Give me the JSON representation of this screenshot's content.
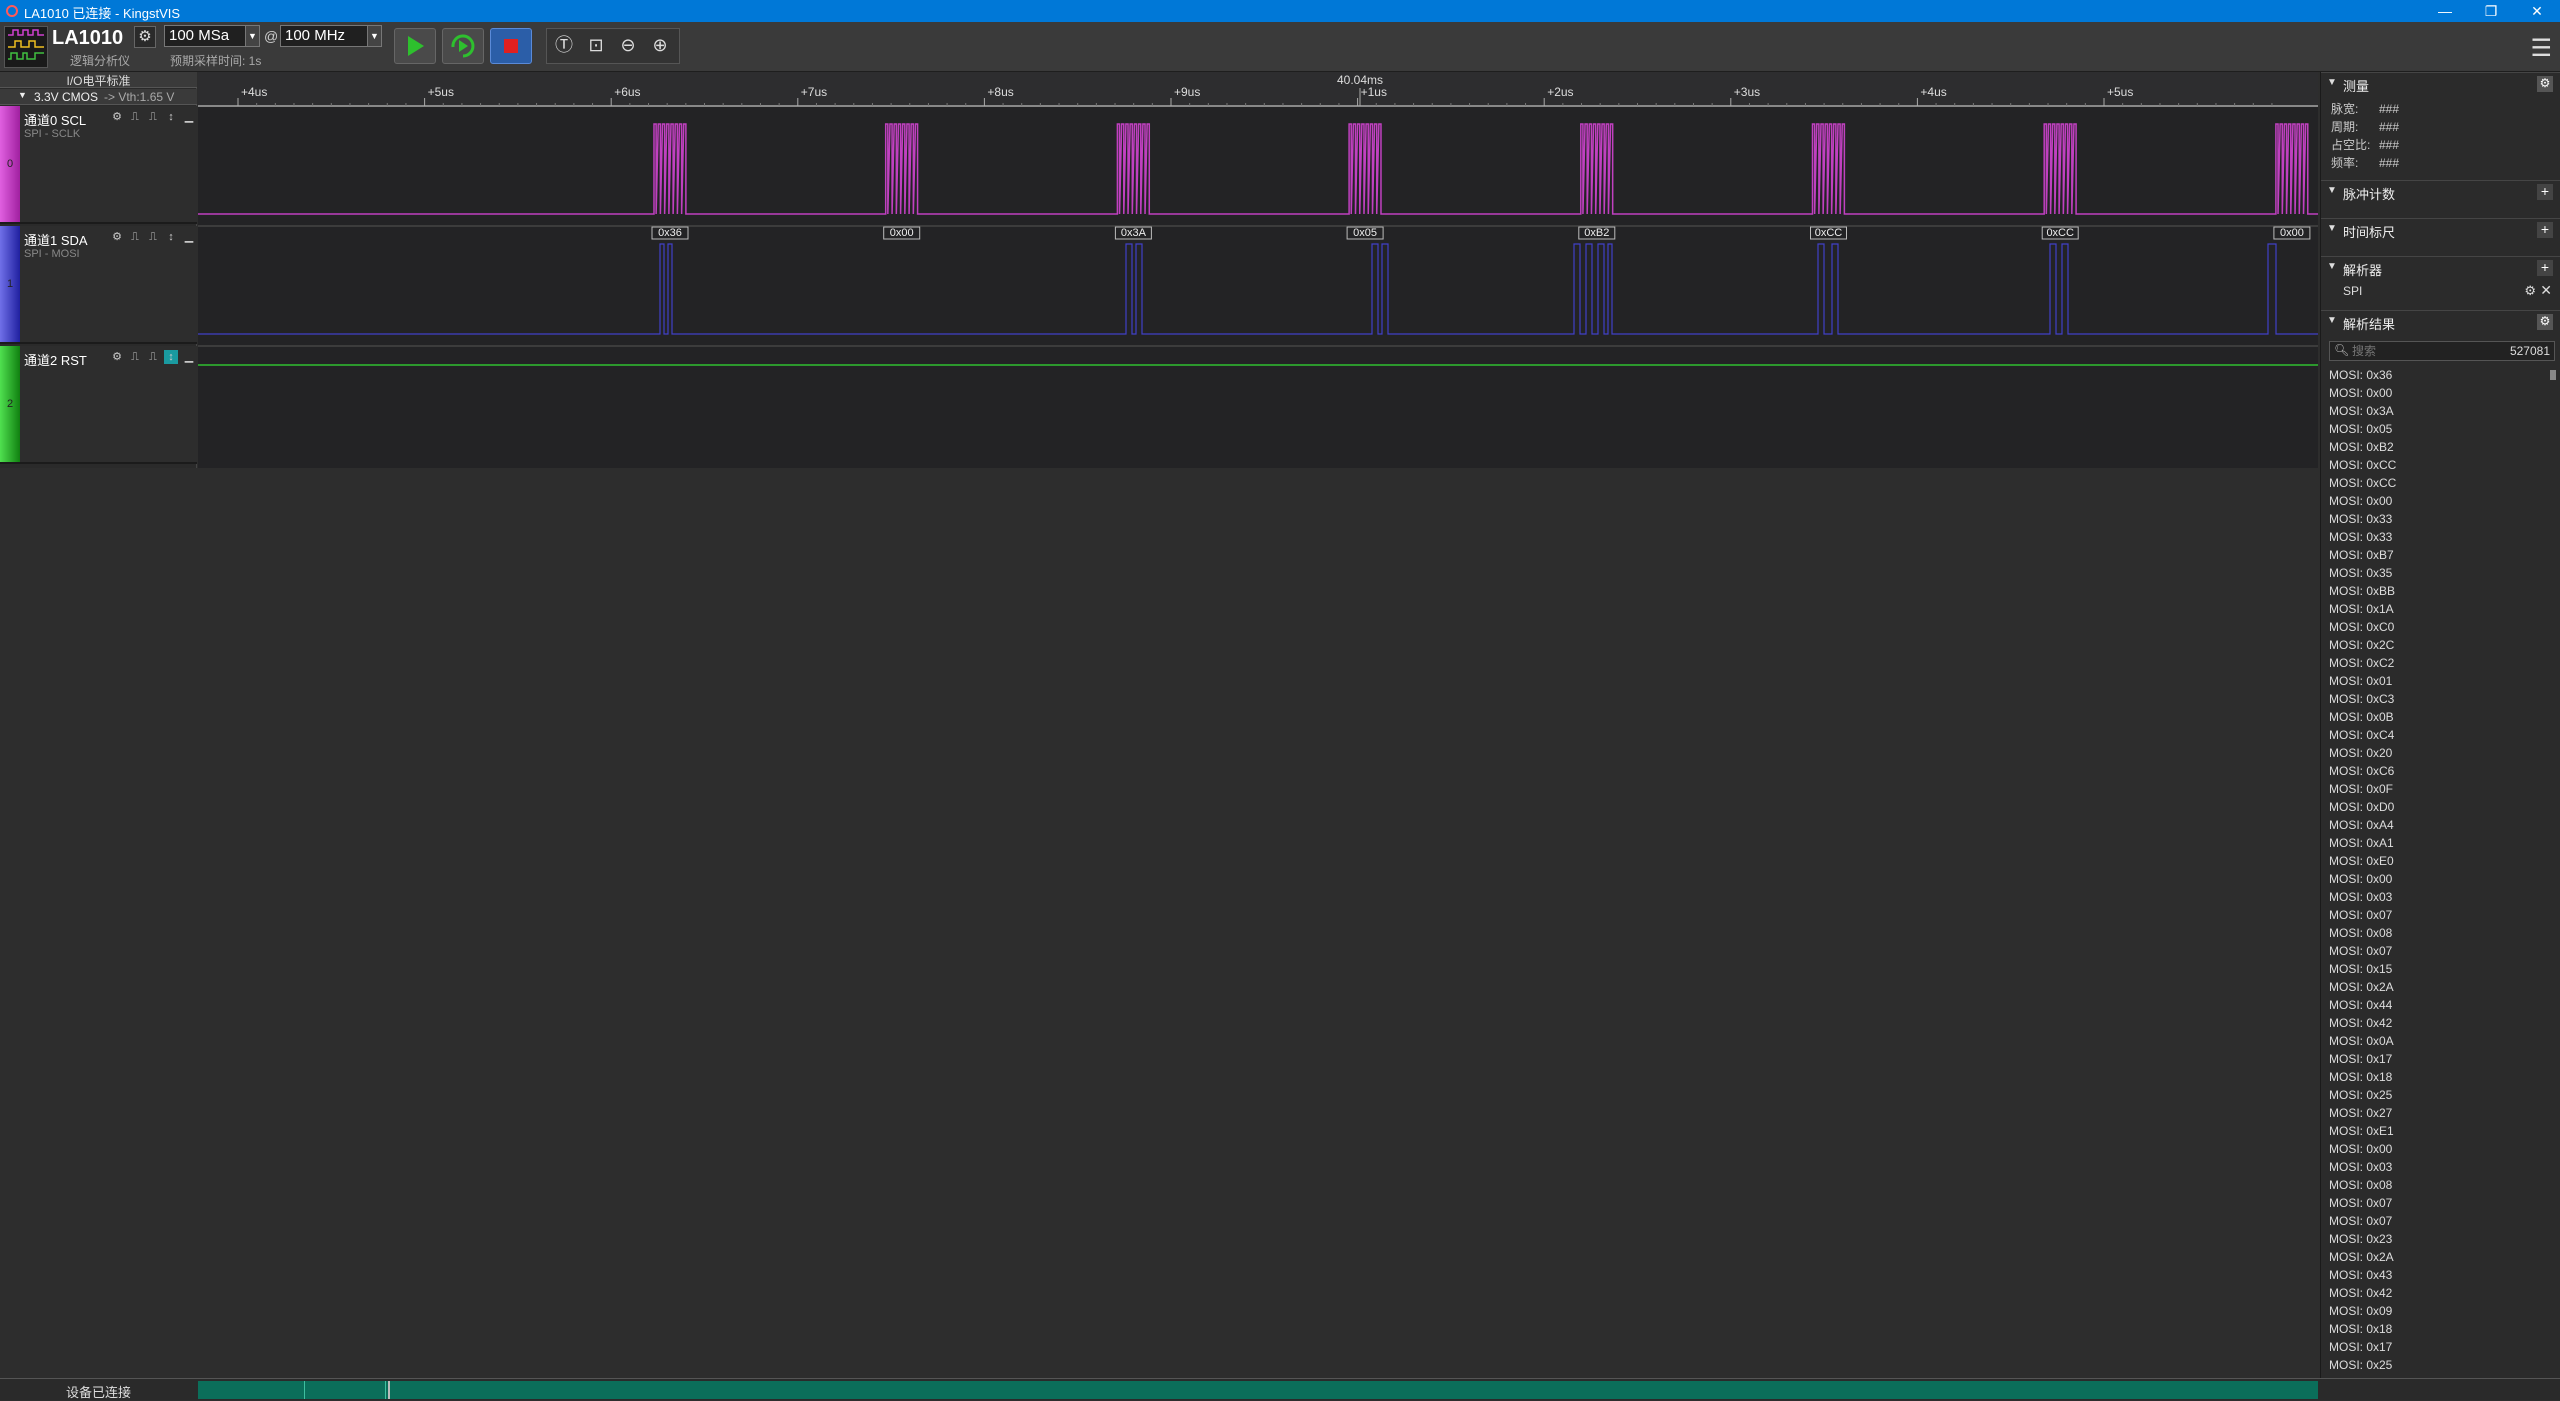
{
  "window": {
    "title": "LA1010 已连接 - KingstVIS",
    "controls": [
      "—",
      "❐",
      "✕"
    ]
  },
  "toolbar": {
    "device_name": "LA1010",
    "device_subtitle": "逻辑分析仪",
    "sample_count": "100 MSa",
    "at_symbol": "@",
    "sample_rate": "100 MHz",
    "preset_time": "预期采样时间: 1s",
    "icons": [
      "play-icon",
      "loop-run-icon",
      "stop-icon",
      "cursor-t-icon",
      "zoom-fit-icon",
      "zoom-out-icon",
      "zoom-in-icon",
      "menu-icon"
    ]
  },
  "io_standard": {
    "header": "I/O电平标准",
    "level": "3.3V CMOS",
    "vth": "-> Vth:1.65 V"
  },
  "channels": [
    {
      "index": "0",
      "name": "通道0 SCL",
      "decoder": "SPI - SCLK",
      "color": "#c040c0"
    },
    {
      "index": "1",
      "name": "通道1 SDA",
      "decoder": "SPI - MOSI",
      "color": "#4040c8"
    },
    {
      "index": "2",
      "name": "通道2 RST",
      "decoder": "",
      "color": "#30c030"
    }
  ],
  "timeline": {
    "center_time": "40.04ms",
    "ticks": [
      "+4us",
      "+5us",
      "+6us",
      "+7us",
      "+8us",
      "+9us",
      "+1us",
      "+2us",
      "+3us",
      "+4us",
      "+5us"
    ]
  },
  "decoded_bytes": [
    "0x36",
    "0x00",
    "0x3A",
    "0x05",
    "0xB2",
    "0xCC",
    "0xCC",
    "0x00"
  ],
  "right_panel": {
    "measure": {
      "title": "测量",
      "rows": [
        {
          "label": "脉宽:",
          "value": "###"
        },
        {
          "label": "周期:",
          "value": "###"
        },
        {
          "label": "占空比:",
          "value": "###"
        },
        {
          "label": "频率:",
          "value": "###"
        }
      ]
    },
    "pulse_count": {
      "title": "脉冲计数"
    },
    "time_ruler": {
      "title": "时间标尺"
    },
    "analyzer": {
      "title": "解析器",
      "item": "SPI"
    },
    "results": {
      "title": "解析结果",
      "search_placeholder": "搜索",
      "count": "527081",
      "items": [
        "MOSI: 0x36",
        "MOSI: 0x00",
        "MOSI: 0x3A",
        "MOSI: 0x05",
        "MOSI: 0xB2",
        "MOSI: 0xCC",
        "MOSI: 0xCC",
        "MOSI: 0x00",
        "MOSI: 0x33",
        "MOSI: 0x33",
        "MOSI: 0xB7",
        "MOSI: 0x35",
        "MOSI: 0xBB",
        "MOSI: 0x1A",
        "MOSI: 0xC0",
        "MOSI: 0x2C",
        "MOSI: 0xC2",
        "MOSI: 0x01",
        "MOSI: 0xC3",
        "MOSI: 0x0B",
        "MOSI: 0xC4",
        "MOSI: 0x20",
        "MOSI: 0xC6",
        "MOSI: 0x0F",
        "MOSI: 0xD0",
        "MOSI: 0xA4",
        "MOSI: 0xA1",
        "MOSI: 0xE0",
        "MOSI: 0x00",
        "MOSI: 0x03",
        "MOSI: 0x07",
        "MOSI: 0x08",
        "MOSI: 0x07",
        "MOSI: 0x15",
        "MOSI: 0x2A",
        "MOSI: 0x44",
        "MOSI: 0x42",
        "MOSI: 0x0A",
        "MOSI: 0x17",
        "MOSI: 0x18",
        "MOSI: 0x25",
        "MOSI: 0x27",
        "MOSI: 0xE1",
        "MOSI: 0x00",
        "MOSI: 0x03",
        "MOSI: 0x08",
        "MOSI: 0x07",
        "MOSI: 0x07",
        "MOSI: 0x23",
        "MOSI: 0x2A",
        "MOSI: 0x43",
        "MOSI: 0x42",
        "MOSI: 0x09",
        "MOSI: 0x18",
        "MOSI: 0x17",
        "MOSI: 0x25"
      ]
    }
  },
  "status": {
    "text": "设备已连接"
  }
}
